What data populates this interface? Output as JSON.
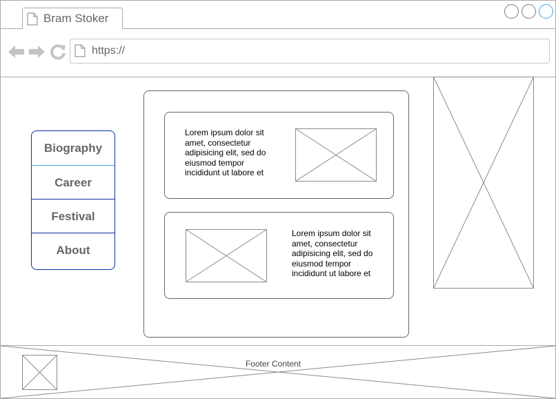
{
  "browser": {
    "tab_title": "Bram Stoker",
    "url": "https://",
    "icons": {
      "tab": "page-icon",
      "back": "arrow-left-icon",
      "forward": "arrow-right-icon",
      "reload": "reload-icon",
      "url": "page-icon"
    },
    "window_buttons": [
      "minimize",
      "restore",
      "maximize"
    ]
  },
  "sidebar": {
    "items": [
      {
        "label": "Biography",
        "active": true
      },
      {
        "label": "Career",
        "active": false
      },
      {
        "label": "Festival",
        "active": false
      },
      {
        "label": "About",
        "active": false
      }
    ]
  },
  "content": {
    "cards": [
      {
        "text": "Lorem ipsum dolor sit amet, consectetur adipisicing elit, sed do eiusmod tempor incididunt ut labore et",
        "image_position": "right"
      },
      {
        "text": "Lorem ipsum dolor sit amet, consectetur adipisicing elit, sed do eiusmod tempor incididunt ut labore et",
        "image_position": "left"
      }
    ]
  },
  "footer": {
    "text": "Footer Content"
  },
  "colors": {
    "border": "#a8a8a8",
    "menu_border": "#0b2ea3",
    "active_accent": "#3ea6e6",
    "text_gray": "#666666"
  }
}
